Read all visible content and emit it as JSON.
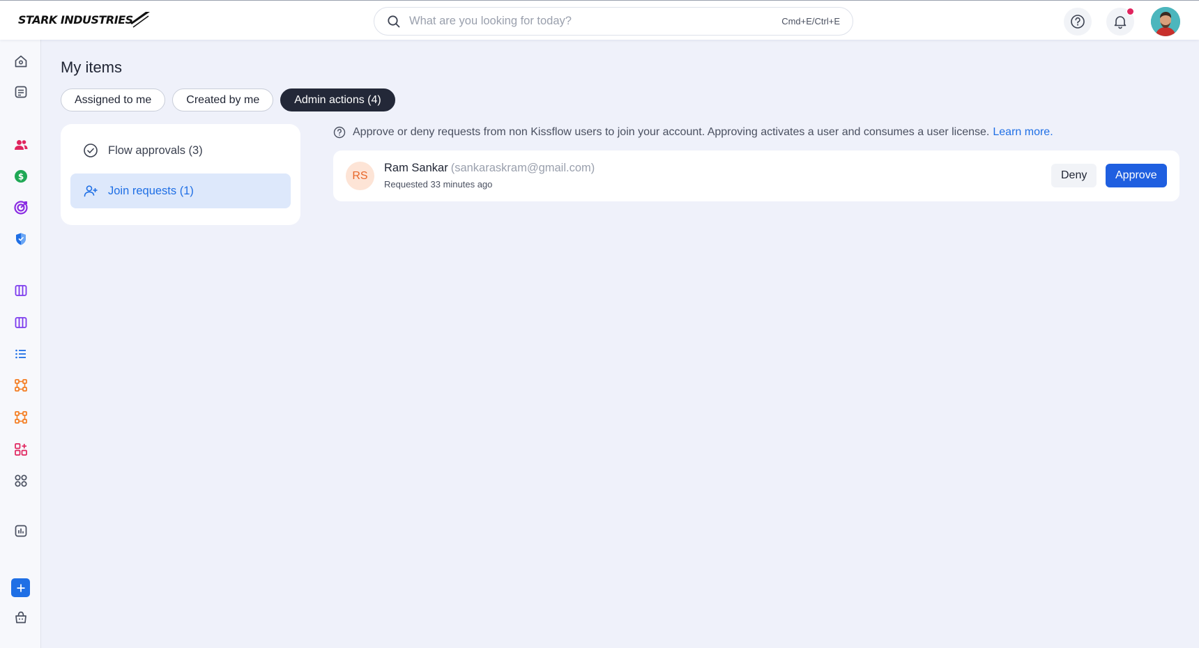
{
  "header": {
    "logo_text": "STARK INDUSTRIES",
    "search": {
      "placeholder": "What are you looking for today?",
      "value": "",
      "shortcut": "Cmd+E/Ctrl+E"
    },
    "icons": [
      "help-icon",
      "bell-icon",
      "user-avatar"
    ],
    "notification_dot": true
  },
  "sidebar": {
    "items": [
      {
        "name": "home-icon",
        "color": "#4a5060"
      },
      {
        "name": "my-items-icon",
        "color": "#4a5060"
      },
      {
        "name": "people-icon",
        "color": "#e0245e"
      },
      {
        "name": "dollar-icon",
        "color": "#1fa855"
      },
      {
        "name": "target-icon",
        "color": "#8a2be2"
      },
      {
        "name": "shield-icon",
        "color": "#1f6fe5"
      },
      {
        "name": "board-icon",
        "color": "#7c3aed"
      },
      {
        "name": "board-icon",
        "color": "#7c3aed"
      },
      {
        "name": "list-icon",
        "color": "#1f6fe5"
      },
      {
        "name": "process-icon",
        "color": "#f47c20"
      },
      {
        "name": "process-icon",
        "color": "#f47c20"
      },
      {
        "name": "apps-add-icon",
        "color": "#e0245e"
      },
      {
        "name": "grid-icon",
        "color": "#4a5060"
      },
      {
        "name": "analytics-icon",
        "color": "#4a5060"
      },
      {
        "name": "add-icon",
        "color": "#1f6fe5"
      },
      {
        "name": "marketplace-icon",
        "color": "#4a5060"
      }
    ]
  },
  "main": {
    "title": "My items",
    "tabs": [
      {
        "label": "Assigned to me",
        "active": false
      },
      {
        "label": "Created by me",
        "active": false
      },
      {
        "label": "Admin actions (4)",
        "active": true
      }
    ],
    "left_panel": {
      "items": [
        {
          "label": "Flow approvals (3)",
          "icon": "check-circle-icon",
          "active": false
        },
        {
          "label": "Join requests (1)",
          "icon": "user-add-icon",
          "active": true
        }
      ]
    },
    "info": {
      "text": "Approve or deny requests from non Kissflow users to join your account. Approving activates a user and consumes a user license.",
      "link": "Learn more."
    },
    "requests": [
      {
        "initials": "RS",
        "name": "Ram Sankar",
        "email": "(sankaraskram@gmail.com)",
        "time": "Requested 33 minutes ago",
        "deny_label": "Deny",
        "approve_label": "Approve"
      }
    ]
  },
  "colors": {
    "accent": "#1f6fe5",
    "approve": "#1f5fe0",
    "active_tab": "#232838",
    "background": "#eff1fa"
  }
}
